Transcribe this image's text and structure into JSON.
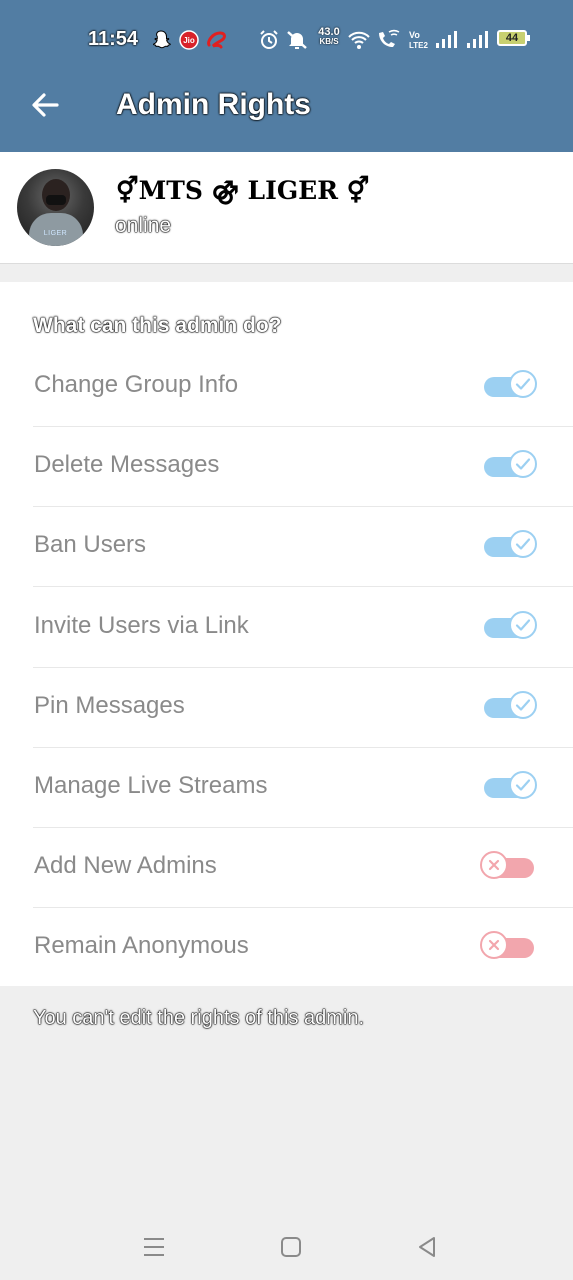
{
  "status_bar": {
    "time": "11:54",
    "net_speed_value": "43.0",
    "net_speed_unit": "KB/S",
    "battery": "44",
    "icons": [
      "snapchat-icon",
      "jio-icon",
      "airtel-icon",
      "alarm-icon",
      "mute-icon",
      "wifi-icon",
      "wifi-call-icon",
      "volte-icon",
      "signal-icon",
      "signal-icon-2",
      "battery-icon"
    ]
  },
  "header": {
    "title": "Admin Rights"
  },
  "profile": {
    "name": "⚥MTS ⚣ LIGER ⚥",
    "status": "online",
    "avatar_caption": "LIGER"
  },
  "rights_section": {
    "title": "What can this admin do?",
    "items": [
      {
        "label": "Change Group Info",
        "enabled": true
      },
      {
        "label": "Delete Messages",
        "enabled": true
      },
      {
        "label": "Ban Users",
        "enabled": true
      },
      {
        "label": "Invite Users via Link",
        "enabled": true
      },
      {
        "label": "Pin Messages",
        "enabled": true
      },
      {
        "label": "Manage Live Streams",
        "enabled": true
      },
      {
        "label": "Add New Admins",
        "enabled": false
      },
      {
        "label": "Remain Anonymous",
        "enabled": false
      }
    ]
  },
  "footer_note": "You can't edit the rights of this admin.",
  "colors": {
    "header_bg": "#527da3",
    "toggle_on": "#9cd0f2",
    "toggle_off": "#f2a6ad",
    "page_bg": "#efefef"
  }
}
